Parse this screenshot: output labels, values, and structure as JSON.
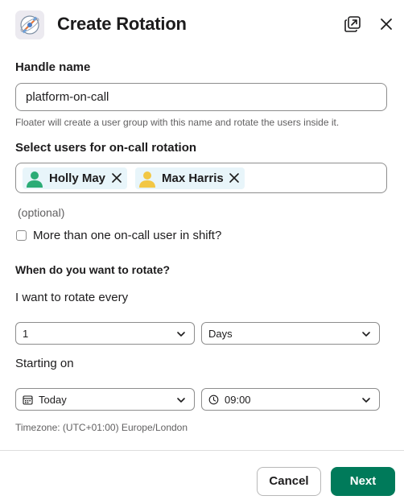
{
  "header": {
    "title": "Create Rotation",
    "app_icon": "floater-satellite-icon",
    "popout_icon": "popout-icon",
    "close_icon": "close-icon"
  },
  "handle": {
    "label": "Handle name",
    "value": "platform-on-call",
    "hint": "Floater will create a user group with this name and rotate the users inside it."
  },
  "users": {
    "label": "Select users for on-call rotation",
    "selected": [
      {
        "name": "Holly May",
        "avatar_color": "#2bac76"
      },
      {
        "name": "Max Harris",
        "avatar_color": "#f2c744"
      }
    ],
    "optional_note": "(optional)"
  },
  "multi_user": {
    "label": "More than one on-call user in shift?",
    "checked": false
  },
  "rotate": {
    "heading": "When do you want to rotate?",
    "every_label": "I want to rotate every",
    "interval_value": "1",
    "interval_unit": "Days",
    "starting_label": "Starting on",
    "start_date": "Today",
    "start_time": "09:00",
    "timezone": "Timezone: (UTC+01:00) Europe/London"
  },
  "footer": {
    "cancel_label": "Cancel",
    "next_label": "Next"
  },
  "colors": {
    "primary": "#007a5a",
    "chip_bg": "#e8f5fa",
    "border": "#8d8d8d"
  }
}
